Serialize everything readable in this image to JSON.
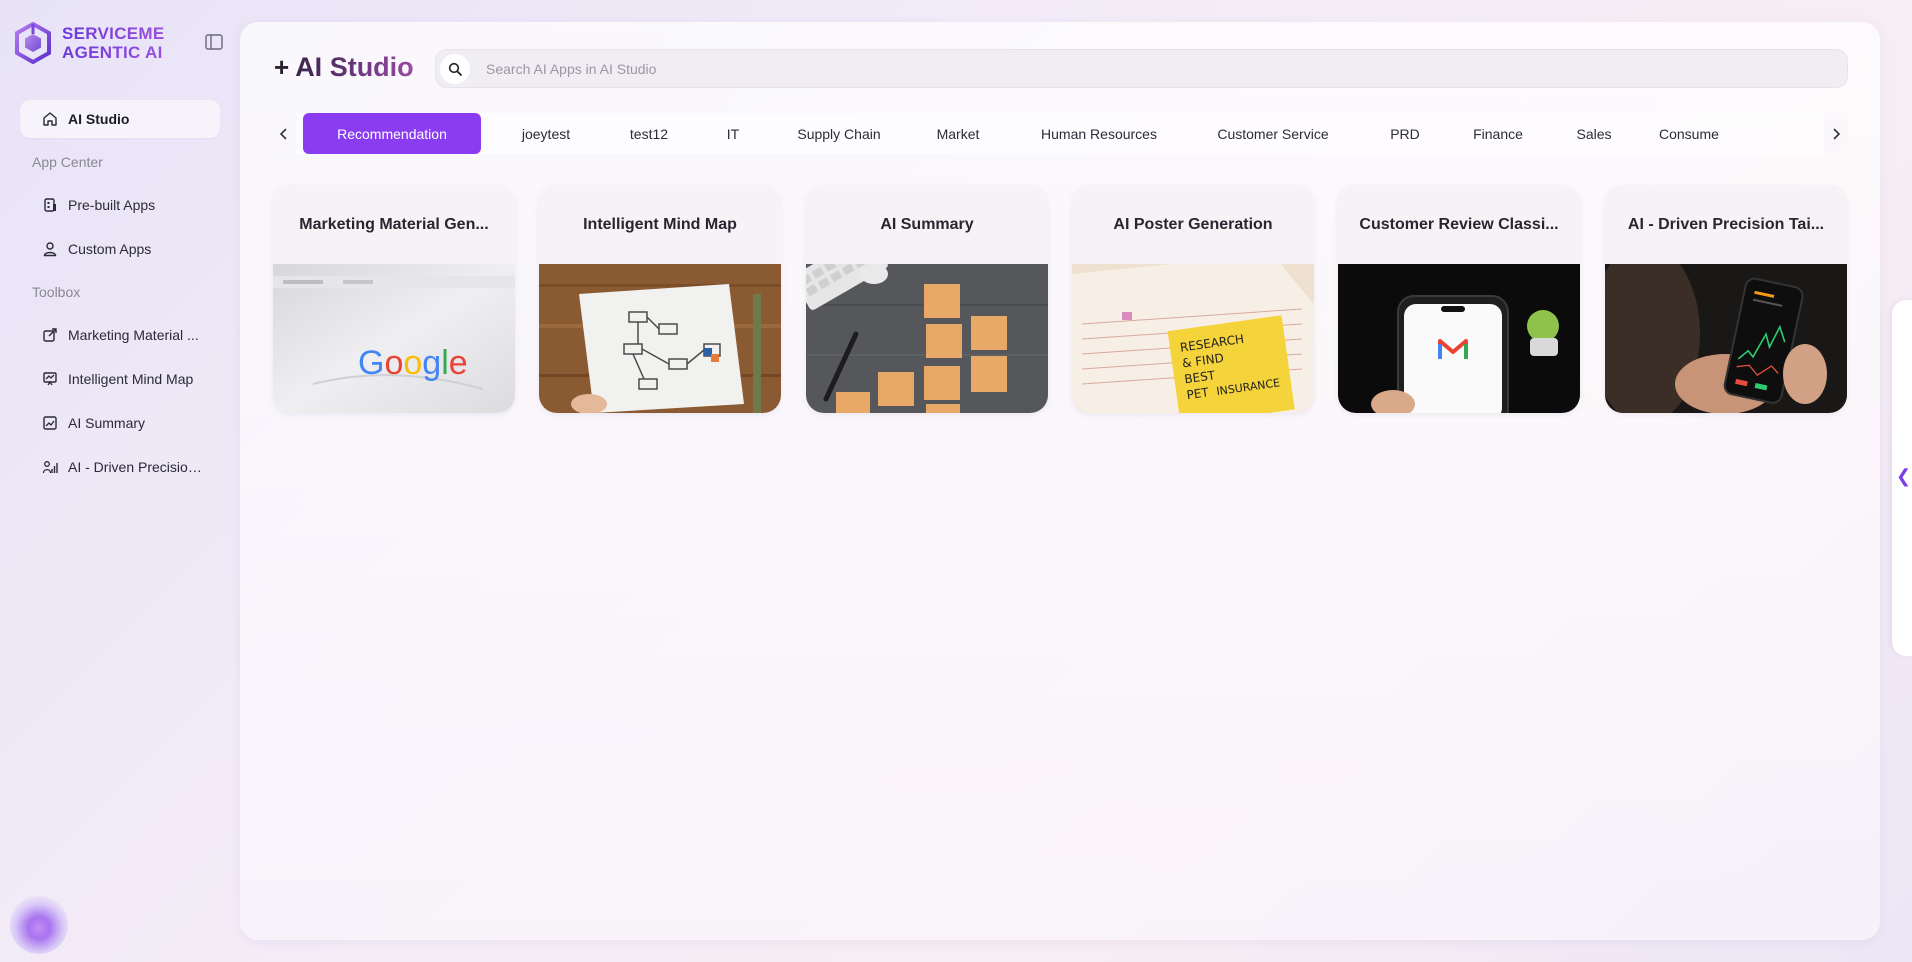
{
  "brand": {
    "line1": "SERVICEME",
    "line2": "AGENTIC AI"
  },
  "sidebar": {
    "active_item": {
      "label": "AI Studio",
      "icon": "home-icon"
    },
    "sections": [
      {
        "label": "App Center",
        "items": [
          {
            "label": "Pre-built Apps",
            "icon": "building-icon"
          },
          {
            "label": "Custom Apps",
            "icon": "user-icon"
          }
        ]
      },
      {
        "label": "Toolbox",
        "items": [
          {
            "label": "Marketing Material ...",
            "icon": "edit-export-icon"
          },
          {
            "label": "Intelligent Mind Map",
            "icon": "chart-board-icon"
          },
          {
            "label": "AI Summary",
            "icon": "image-chart-icon"
          },
          {
            "label": "AI - Driven Precision...",
            "icon": "person-chart-icon"
          }
        ]
      }
    ]
  },
  "header": {
    "plus": "+",
    "title": "AI Studio"
  },
  "search": {
    "placeholder": "Search AI Apps in AI Studio",
    "value": ""
  },
  "tabs": [
    {
      "label": "Recommendation",
      "active": true
    },
    {
      "label": "joeytest"
    },
    {
      "label": "test12"
    },
    {
      "label": "IT"
    },
    {
      "label": "Supply Chain"
    },
    {
      "label": "Market"
    },
    {
      "label": "Human Resources"
    },
    {
      "label": "Customer Service"
    },
    {
      "label": "PRD"
    },
    {
      "label": "Finance"
    },
    {
      "label": "Sales"
    },
    {
      "label": "Consume"
    }
  ],
  "cards": [
    {
      "title": "Marketing Material Gen...",
      "image": "google-screen"
    },
    {
      "title": "Intelligent Mind Map",
      "image": "flowchart-paper"
    },
    {
      "title": "AI Summary",
      "image": "sticky-notes-desk"
    },
    {
      "title": "AI Poster Generation",
      "image": "research-note"
    },
    {
      "title": "Customer Review Classi...",
      "image": "gmail-phone"
    },
    {
      "title": "AI - Driven Precision Tai...",
      "image": "stock-phone"
    }
  ],
  "colors": {
    "accent": "#8a3df0",
    "brand": "#6d3ad8"
  },
  "image_text": {
    "google": "Google",
    "note": [
      "RESEARCH",
      "& FIND",
      "BEST",
      "PET",
      "INSURANCE"
    ]
  }
}
